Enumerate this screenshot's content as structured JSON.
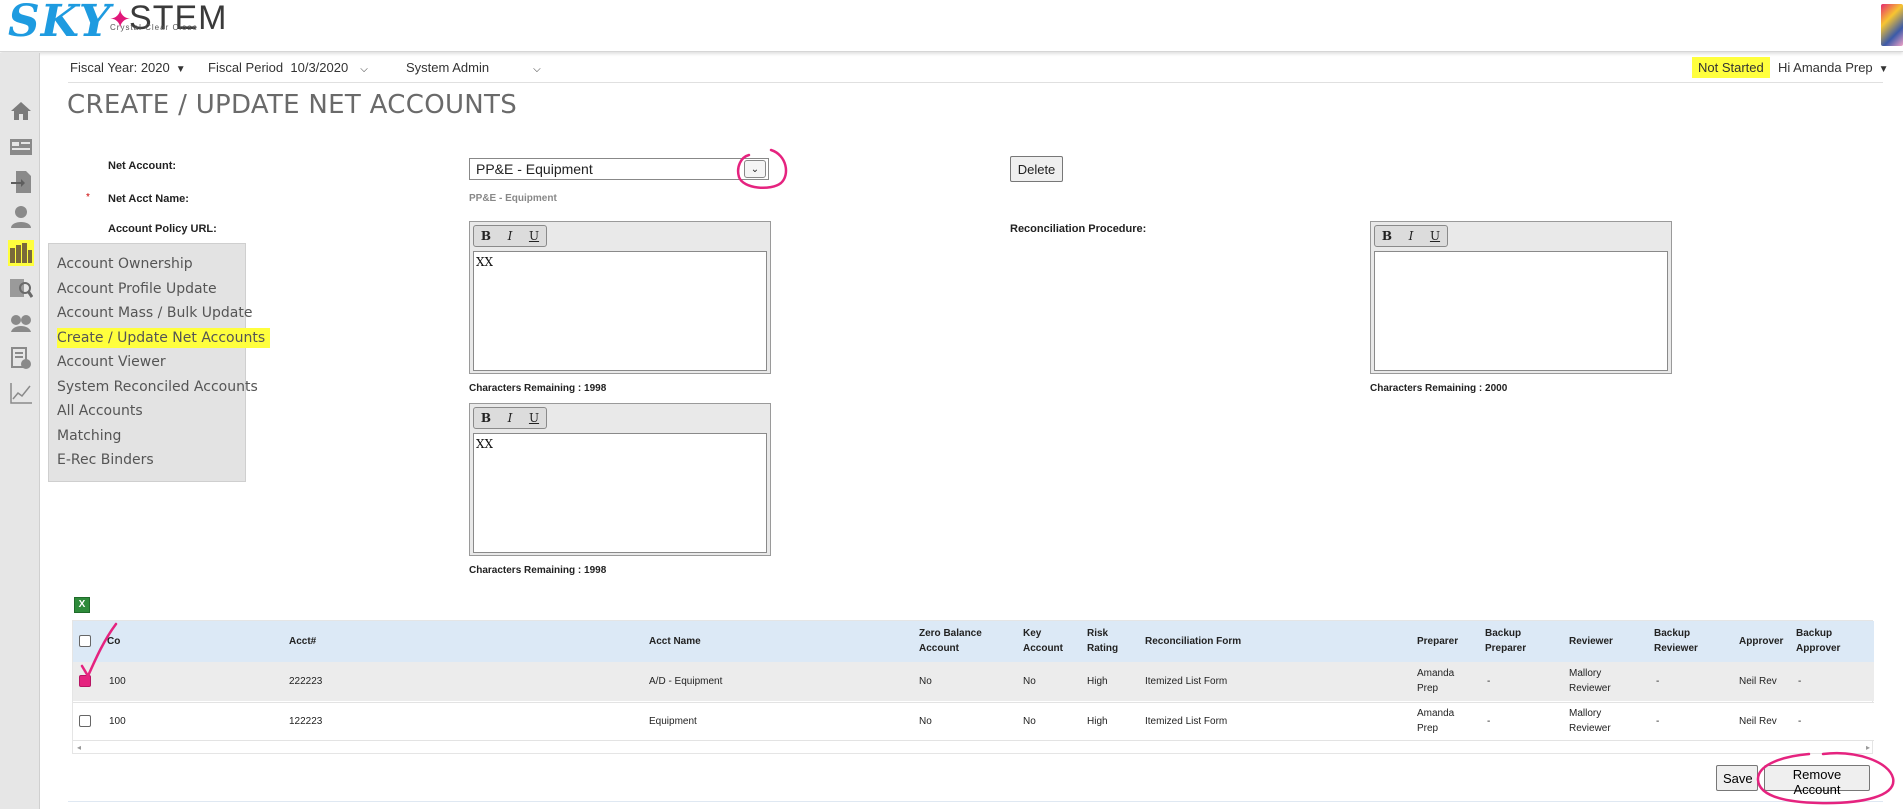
{
  "brand": {
    "logo_sky": "SKY",
    "logo_stem": "STEM",
    "tagline": "Crystal Clear Close"
  },
  "header": {
    "fiscal_year": "Fiscal Year: 2020",
    "fiscal_period_label": "Fiscal Period",
    "fiscal_period_value": "10/3/2020",
    "role": "System Admin",
    "status": "Not Started",
    "greeting": "Hi Amanda Prep"
  },
  "rail": {
    "icons": [
      "home-icon",
      "dashboard-icon",
      "import-icon",
      "user-icon",
      "accounts-icon",
      "search-report-icon",
      "group-icon",
      "certify-icon",
      "chart-icon"
    ]
  },
  "flyout": {
    "items": [
      "Account Ownership",
      "Account Profile Update",
      "Account Mass / Bulk Update",
      "Create / Update Net Accounts",
      "Account Viewer",
      "System Reconciled Accounts",
      "All Accounts",
      "Matching",
      "E-Rec Binders"
    ],
    "selected_index": 3
  },
  "page": {
    "title": "CREATE / UPDATE NET ACCOUNTS"
  },
  "form": {
    "net_account_label": "Net Account:",
    "net_account_value": "PP&E - Equipment",
    "required_mark": "*",
    "net_acct_name_label": "Net Acct Name:",
    "net_acct_name_value": "PP&E - Equipment",
    "policy_url_label": "Account Policy URL:",
    "recon_procedure_label": "Reconciliation Procedure:",
    "delete_label": "Delete",
    "editors": [
      {
        "text": "XX",
        "remaining": "Characters Remaining : 1998"
      },
      {
        "text": "",
        "remaining": "Characters Remaining : 2000"
      },
      {
        "text": "XX",
        "remaining": "Characters Remaining : 1998"
      }
    ],
    "toolbar": {
      "bold": "B",
      "italic": "I",
      "underline": "U"
    }
  },
  "table": {
    "columns": {
      "co": "Co",
      "acct": "Acct#",
      "acct_name": "Acct Name",
      "zero_balance": [
        "Zero Balance",
        "Account"
      ],
      "key_account": [
        "Key",
        "Account"
      ],
      "risk_rating": [
        "Risk",
        "Rating"
      ],
      "recon_form": "Reconciliation Form",
      "preparer": "Preparer",
      "backup_preparer": [
        "Backup",
        "Preparer"
      ],
      "reviewer": "Reviewer",
      "backup_reviewer": [
        "Backup",
        "Reviewer"
      ],
      "approver": "Approver",
      "backup_approver": [
        "Backup",
        "Approver"
      ]
    },
    "rows": [
      {
        "checked": true,
        "co": "100",
        "acct": "222223",
        "acct_name": "A/D - Equipment",
        "zero_balance": "No",
        "key_account": "No",
        "risk_rating": "High",
        "recon_form": "Itemized List Form",
        "preparer": [
          "Amanda",
          "Prep"
        ],
        "backup_preparer": "-",
        "reviewer": [
          "Mallory",
          "Reviewer"
        ],
        "backup_reviewer": "-",
        "approver": "Neil Rev",
        "backup_approver": "-"
      },
      {
        "checked": false,
        "co": "100",
        "acct": "122223",
        "acct_name": "Equipment",
        "zero_balance": "No",
        "key_account": "No",
        "risk_rating": "High",
        "recon_form": "Itemized List Form",
        "preparer": [
          "Amanda",
          "Prep"
        ],
        "backup_preparer": "-",
        "reviewer": [
          "Mallory",
          "Reviewer"
        ],
        "backup_reviewer": "-",
        "approver": "Neil Rev",
        "backup_approver": "-"
      }
    ]
  },
  "actions": {
    "save_label": "Save",
    "remove_label": "Remove Account"
  },
  "colors": {
    "highlight": "#ffff3d",
    "annotation": "#e5237f",
    "table_header": "#dce9f6",
    "brand_blue": "#1e9be0"
  }
}
